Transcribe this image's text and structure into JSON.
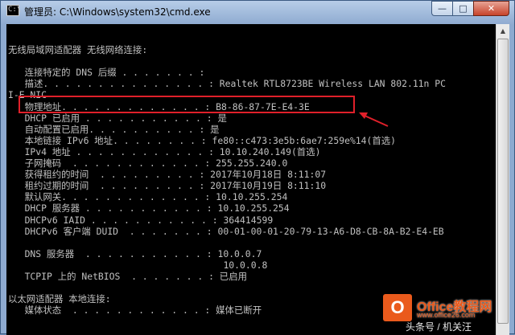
{
  "window": {
    "title": "管理员: C:\\Windows\\system32\\cmd.exe",
    "icon_label": "C:\\",
    "buttons": {
      "minimize": "—",
      "maximize": "□",
      "close": "✕"
    }
  },
  "console": {
    "lines": [
      "",
      "无线局域网适配器 无线网络连接:",
      "",
      "   连接特定的 DNS 后缀 . . . . . . . :",
      "   描述. . . . . . . . . . . . . . . : Realtek RTL8723BE Wireless LAN 802.11n PC",
      "I-E NIC",
      "   物理地址. . . . . . . . . . . . . : B8-86-87-7E-E4-3E",
      "   DHCP 已启用 . . . . . . . . . . . : 是",
      "   自动配置已启用. . . . . . . . . . : 是",
      "   本地链接 IPv6 地址. . . . . . . . : fe80::c473:3e5b:6ae7:259e%14(首选)",
      "   IPv4 地址 . . . . . . . . . . . . : 10.10.240.149(首选)",
      "   子网掩码  . . . . . . . . . . . . : 255.255.240.0",
      "   获得租约的时间  . . . . . . . . . : 2017年10月18日 8:11:07",
      "   租约过期的时间  . . . . . . . . . : 2017年10月19日 8:11:10",
      "   默认网关. . . . . . . . . . . . . : 10.10.255.254",
      "   DHCP 服务器 . . . . . . . . . . . : 10.10.255.254",
      "   DHCPv6 IAID . . . . . . . . . . . : 364414599",
      "   DHCPv6 客户端 DUID  . . . . . . . : 00-01-00-01-20-79-13-A6-D8-CB-8A-B2-E4-EB",
      "",
      "   DNS 服务器  . . . . . . . . . . . : 10.0.0.7",
      "                                       10.0.0.8",
      "   TCPIP 上的 NetBIOS  . . . . . . . : 已启用",
      "",
      "以太网适配器 本地连接:",
      "   媒体状态  . . . . . . . . . . . . : 媒体已断开"
    ]
  },
  "annotation": {
    "color": "#e0202a"
  },
  "watermark": {
    "logo_letter": "O",
    "title": "Office教程网",
    "url": "www.office26.com",
    "source": "头条号 / 机关汪"
  }
}
